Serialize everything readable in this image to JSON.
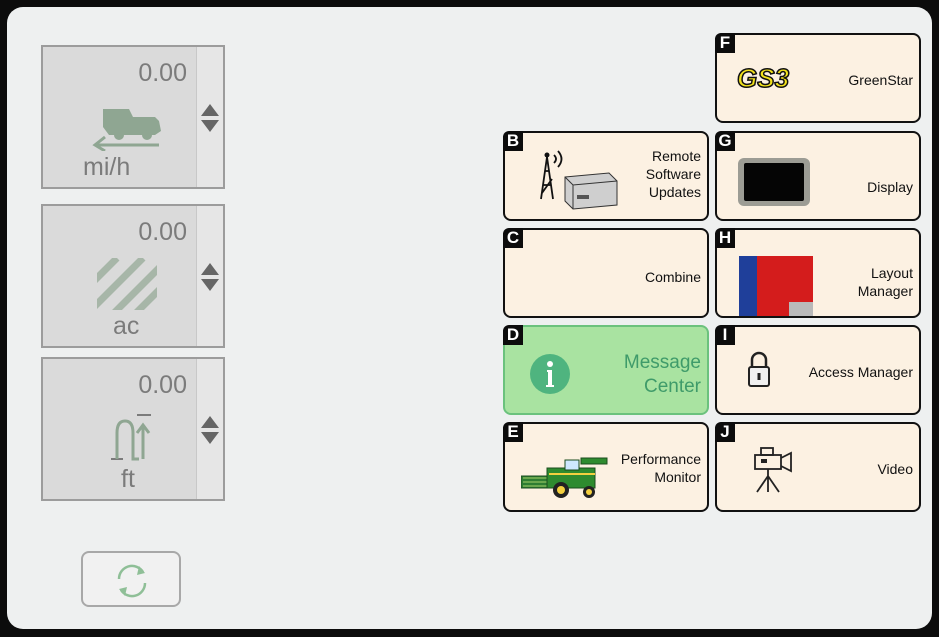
{
  "gauges": [
    {
      "value": "0.00",
      "unit": "mi/h",
      "icon": "ground-speed-icon"
    },
    {
      "value": "0.00",
      "unit": "ac",
      "icon": "area-icon"
    },
    {
      "value": "0.00",
      "unit": "ft",
      "icon": "implement-height-icon"
    }
  ],
  "tiles": {
    "F": {
      "letter": "F",
      "label": "GreenStar",
      "logo": "GS3",
      "icon": "gs3-logo-icon"
    },
    "B": {
      "letter": "B",
      "line1": "Remote",
      "line2": "Software",
      "line3": "Updates",
      "icon": "radio-tower-icon"
    },
    "G": {
      "letter": "G",
      "label": "Display",
      "icon": "display-icon"
    },
    "C": {
      "letter": "C",
      "label": "Combine"
    },
    "H": {
      "letter": "H",
      "line1": "Layout",
      "line2": "Manager",
      "icon": "layout-icon"
    },
    "D": {
      "letter": "D",
      "line1": "Message",
      "line2": "Center",
      "icon": "info-icon"
    },
    "I": {
      "letter": "I",
      "label": "Access Manager",
      "icon": "lock-icon"
    },
    "E": {
      "letter": "E",
      "line1": "Performance",
      "line2": "Monitor",
      "icon": "combine-harvester-icon"
    },
    "J": {
      "letter": "J",
      "label": "Video",
      "icon": "video-camera-icon"
    }
  },
  "colors": {
    "active_tile": "#a9e3a1",
    "tile_bg": "#fcf1e2",
    "message_text": "#3f9b6a"
  },
  "sync_button": {
    "icon": "sync-icon"
  }
}
